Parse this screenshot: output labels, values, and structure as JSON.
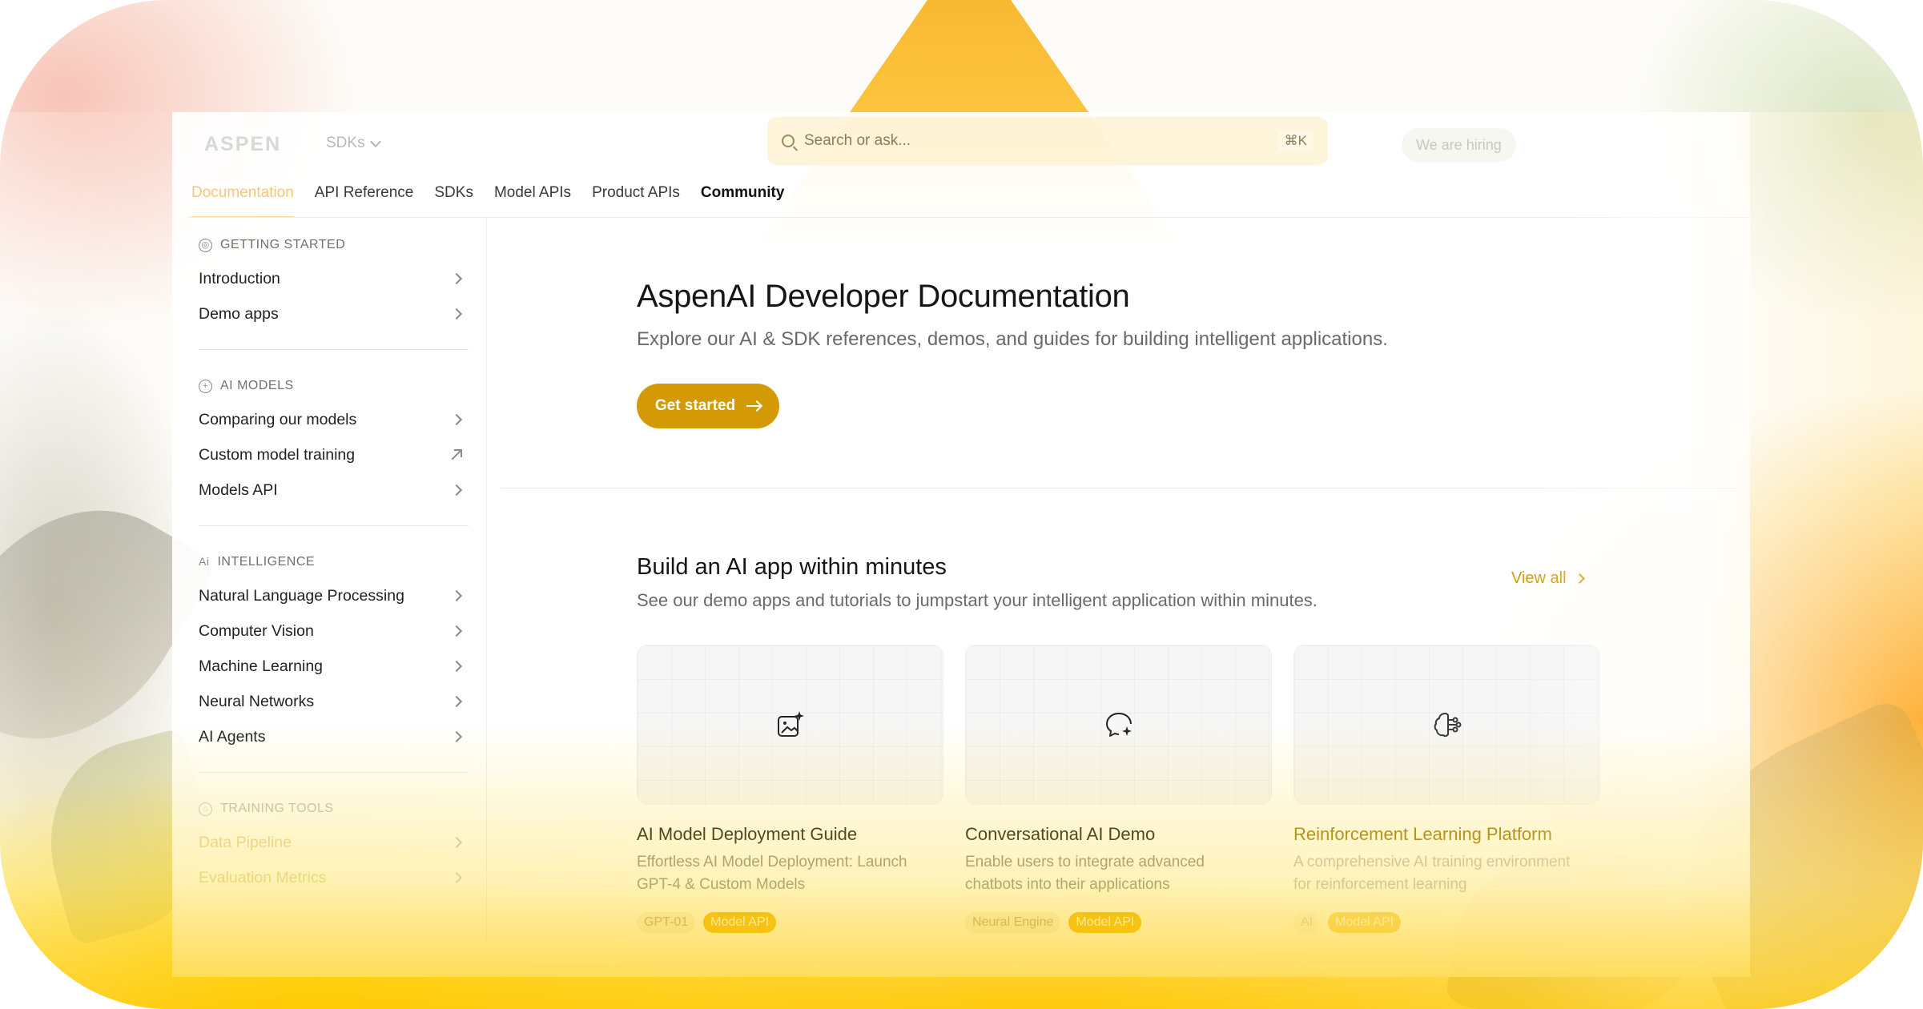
{
  "header": {
    "logo_text": "ASPEN",
    "sdk_select": "SDKs",
    "search_placeholder": "Search or ask...",
    "search_shortcut": "⌘K",
    "hiring_label": "We are hiring"
  },
  "tabs": [
    {
      "label": "Documentation",
      "active": true
    },
    {
      "label": "API Reference"
    },
    {
      "label": "SDKs"
    },
    {
      "label": "Model APIs"
    },
    {
      "label": "Product APIs"
    },
    {
      "label": "Community"
    }
  ],
  "sidebar": {
    "getting_started": {
      "title": "GETTING STARTED",
      "icon": "compass-icon",
      "items": [
        "Introduction",
        "Demo apps"
      ]
    },
    "ai_models": {
      "title": "AI MODELS",
      "icon": "plus-circle-icon",
      "items": [
        "Comparing our models",
        "Custom model training",
        "Models API"
      ]
    },
    "intelligence": {
      "title": "INTELLIGENCE",
      "icon": "ai-text-icon",
      "icon_text": "Ai",
      "items": [
        "Natural Language Processing",
        "Computer Vision",
        "Machine Learning",
        "Neural Networks",
        "AI Agents"
      ]
    },
    "training_tools": {
      "title": "TRAINING TOOLS",
      "icon": "toolbox-icon",
      "items": [
        "Data Pipeline",
        "Evaluation Metrics"
      ]
    }
  },
  "hero": {
    "title": "AspenAI Developer Documentation",
    "subtitle": "Explore our AI & SDK references, demos, and guides for building intelligent applications.",
    "cta": "Get started"
  },
  "demos": {
    "title": "Build an AI app within minutes",
    "subtitle": "See our demo apps and tutorials to jumpstart your intelligent application within minutes.",
    "view_all": "View all",
    "cards": [
      {
        "icon": "sparkle-image-icon",
        "title": "AI Model Deployment Guide",
        "desc_line1": "Effortless AI Model Deployment: Launch",
        "desc_line2": "GPT-4 & Custom Models",
        "tag1": "GPT-01",
        "tag2": "Model API"
      },
      {
        "icon": "chat-sparkle-icon",
        "title": "Conversational AI Demo",
        "desc_line1": "Enable users to integrate advanced",
        "desc_line2": "chatbots into their applications",
        "tag1": "Neural Engine",
        "tag2": "Model API"
      },
      {
        "icon": "brain-circuit-icon",
        "title": "Reinforcement Learning Platform",
        "desc_line1": "A comprehensive AI training environment",
        "desc_line2": "for reinforcement learning",
        "tag1": "AI",
        "tag2": "Model API"
      }
    ]
  },
  "colors": {
    "accent": "#d39a06",
    "tag_accent": "#f1b40a",
    "active_tab": "#f2c87a"
  }
}
